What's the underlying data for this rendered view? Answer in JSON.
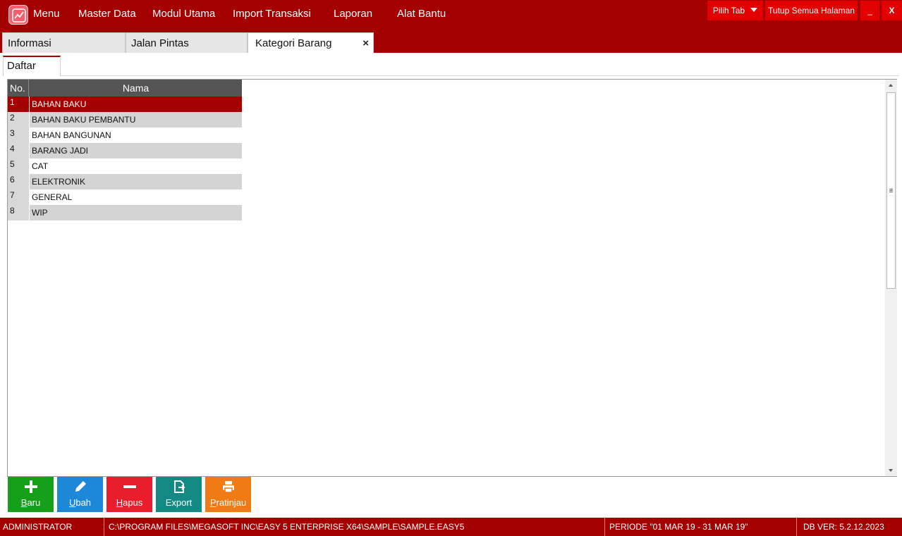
{
  "menu": {
    "items": [
      "Menu",
      "Master Data",
      "Modul Utama",
      "Import Transaksi",
      "Laporan",
      "Alat Bantu"
    ]
  },
  "window_controls": {
    "pilih_tab": "Pilih Tab",
    "tutup_semua": "Tutup Semua Halaman",
    "minimize": "_",
    "close": "X"
  },
  "doc_tabs": [
    {
      "label": "Informasi"
    },
    {
      "label": "Jalan Pintas"
    },
    {
      "label": "Kategori Barang",
      "close": "×"
    }
  ],
  "subtab": {
    "label": "Daftar"
  },
  "grid": {
    "headers": {
      "no": "No.",
      "nama": "Nama"
    },
    "rows": [
      {
        "no": "1",
        "nama": "BAHAN BAKU"
      },
      {
        "no": "2",
        "nama": "BAHAN BAKU PEMBANTU"
      },
      {
        "no": "3",
        "nama": "BAHAN BANGUNAN"
      },
      {
        "no": "4",
        "nama": "BARANG JADI"
      },
      {
        "no": "5",
        "nama": "CAT"
      },
      {
        "no": "6",
        "nama": "ELEKTRONIK"
      },
      {
        "no": "7",
        "nama": "GENERAL"
      },
      {
        "no": "8",
        "nama": "WIP"
      }
    ],
    "selected_row": 1
  },
  "actions": [
    {
      "first": "B",
      "rest": "aru",
      "color": "#16a01a",
      "icon": "plus-icon"
    },
    {
      "first": "U",
      "rest": "bah",
      "color": "#1e88d8",
      "icon": "pencil-icon"
    },
    {
      "first": "H",
      "rest": "apus",
      "color": "#ea1d2c",
      "icon": "minus-icon"
    },
    {
      "first": "",
      "rest": "Export",
      "color": "#138a84",
      "icon": "export-icon"
    },
    {
      "first": "P",
      "rest": "ratinjau",
      "color": "#f07a14",
      "icon": "printer-icon"
    }
  ],
  "status": {
    "user": "ADMINISTRATOR",
    "path": "C:\\PROGRAM FILES\\MEGASOFT INC\\EASY 5 ENTERPRISE X64\\SAMPLE\\SAMPLE.EASY5",
    "periode": "PERIODE \"01 MAR 19 - 31 MAR 19\"",
    "db_ver": "DB VER: 5.2.12.2023"
  },
  "colors": {
    "brand": "#a50000",
    "button_red": "#e30000",
    "header_gray": "#545454"
  }
}
